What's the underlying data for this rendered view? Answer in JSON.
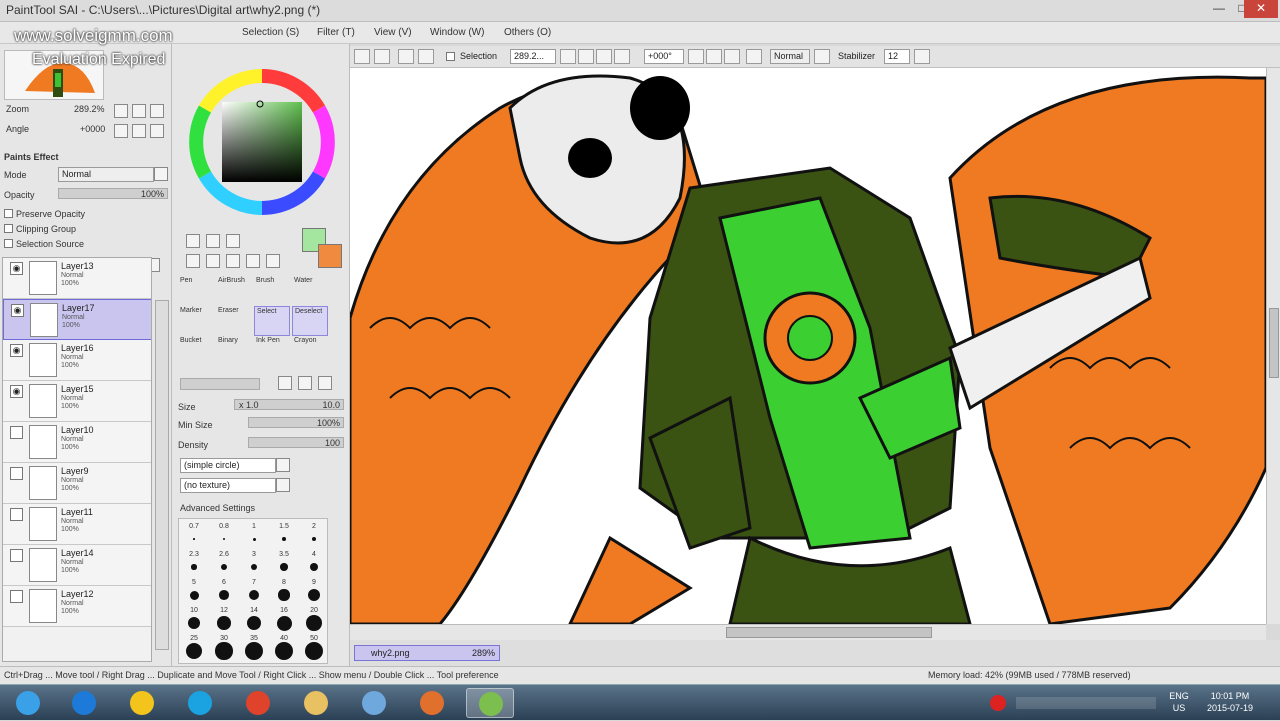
{
  "window": {
    "title": "PaintTool SAI - C:\\Users\\...\\Pictures\\Digital art\\why2.png (*)",
    "min": "—",
    "max": "□",
    "close": "✕"
  },
  "watermark": {
    "site": "www.solveigmm.com",
    "notice": "Evaluation Expired"
  },
  "menu": [
    {
      "label": "Selection (S)"
    },
    {
      "label": "Filter (T)"
    },
    {
      "label": "View (V)"
    },
    {
      "label": "Window (W)"
    },
    {
      "label": "Others (O)"
    }
  ],
  "toolbar": {
    "selection_label": "Selection",
    "zoom_value": "289.2...",
    "angle_value": "+000°",
    "blend_mode": "Normal",
    "stabilizer_label": "Stabilizer",
    "stabilizer_value": "12"
  },
  "navigator": {
    "zoom_label": "Zoom",
    "zoom_value": "289.2%",
    "angle_label": "Angle",
    "angle_value": "+0000"
  },
  "paint_effect": {
    "header": "Paints Effect",
    "mode_label": "Mode",
    "mode_value": "Normal",
    "opacity_label": "Opacity",
    "opacity_value": "100%",
    "preserve_opacity": "Preserve Opacity",
    "clipping_group": "Clipping Group",
    "selection_source": "Selection Source"
  },
  "layers": [
    {
      "name": "Layer13",
      "mode": "Normal",
      "opacity": "100%",
      "visible": true,
      "selected": false
    },
    {
      "name": "Layer17",
      "mode": "Normal",
      "opacity": "100%",
      "visible": true,
      "selected": true
    },
    {
      "name": "Layer16",
      "mode": "Normal",
      "opacity": "100%",
      "visible": true,
      "selected": false
    },
    {
      "name": "Layer15",
      "mode": "Normal",
      "opacity": "100%",
      "visible": true,
      "selected": false
    },
    {
      "name": "Layer10",
      "mode": "Normal",
      "opacity": "100%",
      "visible": false,
      "selected": false
    },
    {
      "name": "Layer9",
      "mode": "Normal",
      "opacity": "100%",
      "visible": false,
      "selected": false
    },
    {
      "name": "Layer11",
      "mode": "Normal",
      "opacity": "100%",
      "visible": false,
      "selected": false
    },
    {
      "name": "Layer14",
      "mode": "Normal",
      "opacity": "100%",
      "visible": false,
      "selected": false
    },
    {
      "name": "Layer12",
      "mode": "Normal",
      "opacity": "100%",
      "visible": false,
      "selected": false
    }
  ],
  "colors": {
    "primary": "#a4e6a0",
    "secondary": "#f08a3e",
    "accent": "#6f6ad8"
  },
  "tools": [
    {
      "label": "Pen"
    },
    {
      "label": "AirBrush"
    },
    {
      "label": "Brush"
    },
    {
      "label": "Water"
    },
    {
      "label": "Marker"
    },
    {
      "label": "Eraser"
    },
    {
      "label": "Select"
    },
    {
      "label": "Deselect"
    },
    {
      "label": "Bucket"
    },
    {
      "label": "Binary"
    },
    {
      "label": "Ink Pen"
    },
    {
      "label": "Crayon"
    }
  ],
  "brush": {
    "size_label": "Size",
    "size_mult": "x 1.0",
    "size_value": "10.0",
    "minsize_label": "Min Size",
    "minsize_value": "100%",
    "density_label": "Density",
    "density_value": "100",
    "shape": "(simple circle)",
    "texture": "(no texture)",
    "advanced": "Advanced Settings",
    "presets": [
      {
        "label": "0.7"
      },
      {
        "label": "0.8"
      },
      {
        "label": "1"
      },
      {
        "label": "1.5"
      },
      {
        "label": "2"
      },
      {
        "label": "2.3"
      },
      {
        "label": "2.6"
      },
      {
        "label": "3"
      },
      {
        "label": "3.5"
      },
      {
        "label": "4"
      },
      {
        "label": "5"
      },
      {
        "label": "6"
      },
      {
        "label": "7"
      },
      {
        "label": "8"
      },
      {
        "label": "9"
      },
      {
        "label": "10"
      },
      {
        "label": "12"
      },
      {
        "label": "14"
      },
      {
        "label": "16"
      },
      {
        "label": "20"
      },
      {
        "label": "25"
      },
      {
        "label": "30"
      },
      {
        "label": "35"
      },
      {
        "label": "40"
      },
      {
        "label": "50"
      }
    ]
  },
  "document_tab": {
    "name": "why2.png",
    "zoom": "289%"
  },
  "status": {
    "hint": "Ctrl+Drag ... Move tool / Right Drag ... Duplicate and Move Tool / Right Click ... Show menu / Double Click ... Tool preference",
    "memory": "Memory load: 42% (99MB used / 778MB reserved)"
  },
  "taskbar": {
    "apps": [
      {
        "icon": "windows-start-icon"
      },
      {
        "icon": "internet-explorer-icon"
      },
      {
        "icon": "messenger-icon"
      },
      {
        "icon": "skype-icon"
      },
      {
        "icon": "chrome-icon"
      },
      {
        "icon": "file-explorer-icon"
      },
      {
        "icon": "itunes-icon"
      },
      {
        "icon": "media-player-icon"
      },
      {
        "icon": "painttool-sai-icon"
      }
    ],
    "lang": "ENG",
    "region": "US",
    "time": "10:01 PM",
    "date": "2015-07-19"
  }
}
